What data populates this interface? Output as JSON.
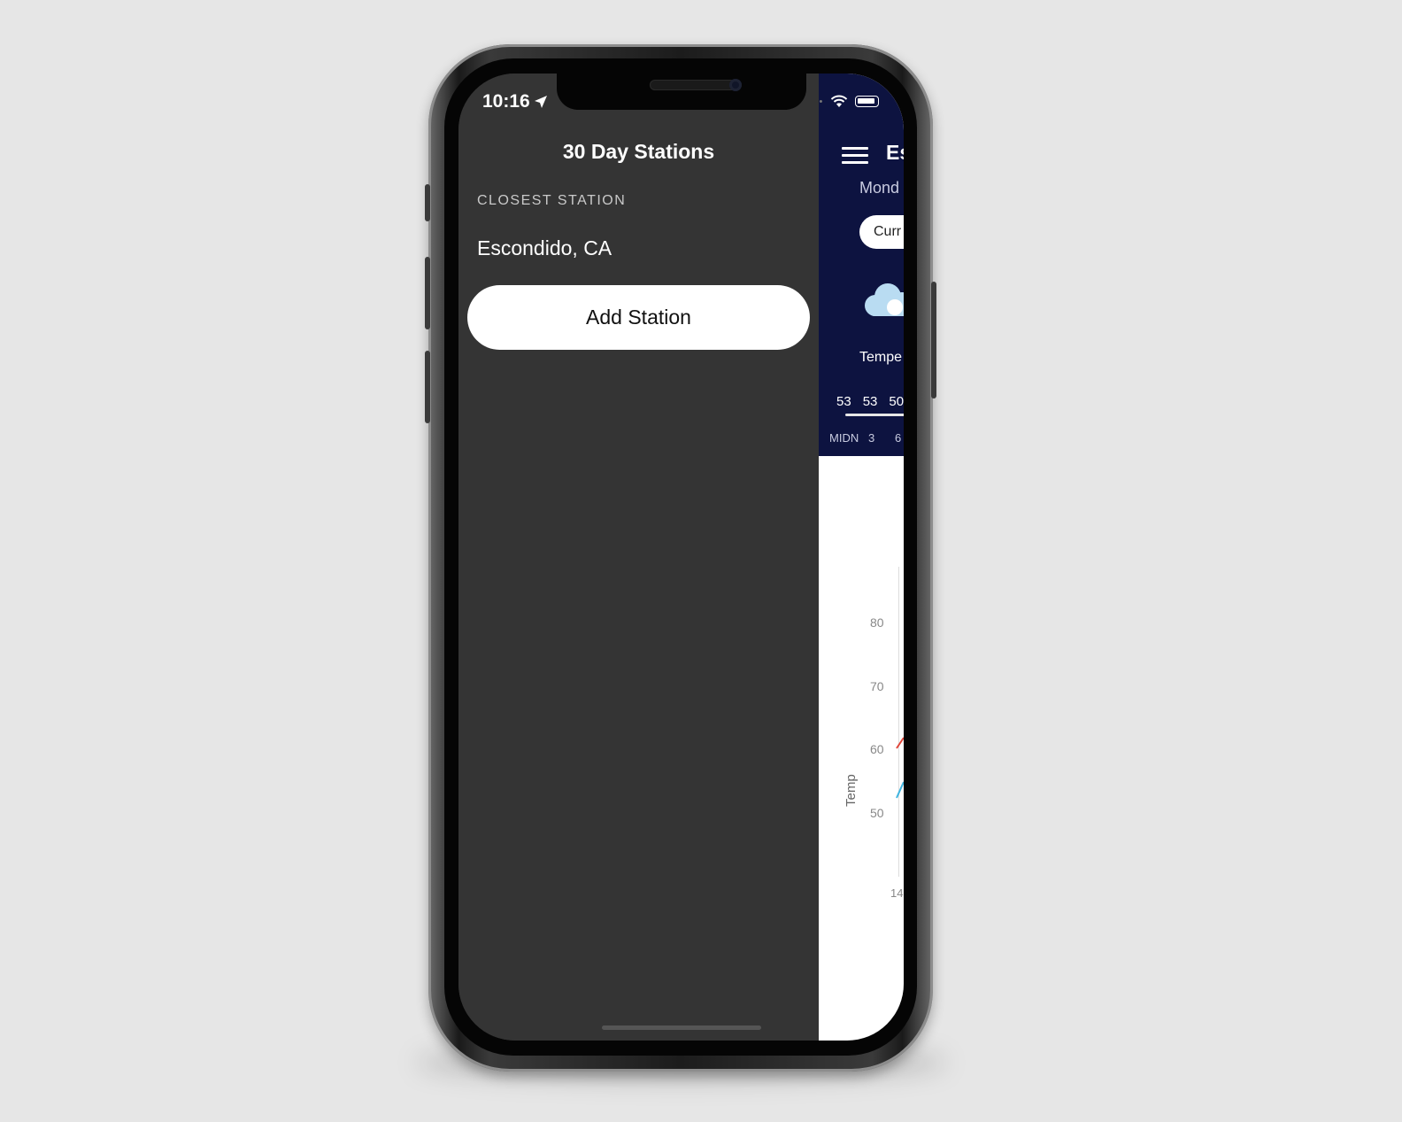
{
  "status_bar": {
    "time": "10:16"
  },
  "drawer": {
    "title": "30 Day Stations",
    "section_label": "CLOSEST STATION",
    "closest_station": "Escondido, CA",
    "add_button_label": "Add Station"
  },
  "main": {
    "city": "Es",
    "date": "Mond",
    "pill_label": "Curr",
    "temperature_label": "Tempe",
    "hourly_temps": [
      "53",
      "53",
      "50"
    ],
    "hour_labels": [
      "MIDN",
      "3",
      "6"
    ],
    "chart": {
      "y_ticks": [
        "80",
        "70",
        "60",
        "50"
      ],
      "ylabel": "Temp",
      "x_tick": "14"
    }
  },
  "colors": {
    "drawer_bg": "#343434",
    "header_bg": "#0d1340",
    "button_bg": "#ffffff"
  }
}
